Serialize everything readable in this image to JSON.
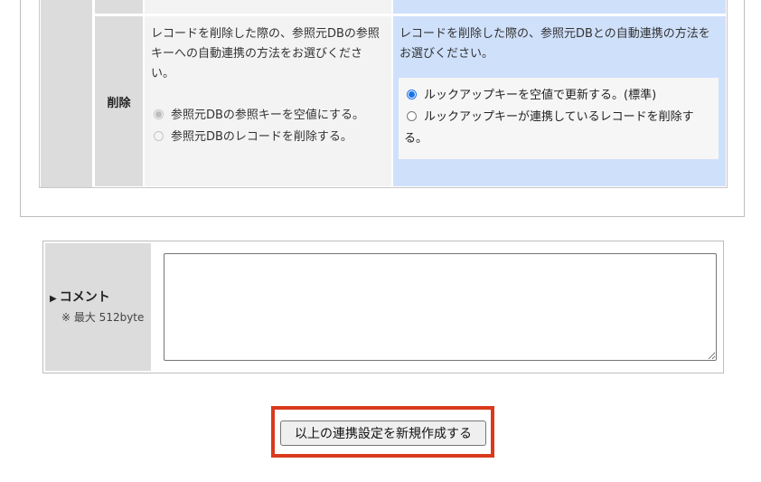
{
  "relation_settings": {
    "delete_row": {
      "label": "削除",
      "current_description": "レコードを削除した際の、参照元DBの参照キーへの自動連携の方法をお選びください。",
      "current_options": [
        {
          "label": "参照元DBの参照キーを空値にする。",
          "checked": true,
          "disabled": true
        },
        {
          "label": "参照元DBのレコードを削除する。",
          "checked": false,
          "disabled": true
        }
      ],
      "new_description": "レコードを削除した際の、参照元DBとの自動連携の方法をお選びください。",
      "new_options": [
        {
          "label": "ルックアップキーを空値で更新する。(標準)",
          "checked": true
        },
        {
          "label": "ルックアップキーが連携しているレコードを削除する。",
          "checked": false
        }
      ]
    }
  },
  "comment": {
    "title": "コメント",
    "note": "※ 最大 512byte",
    "value": ""
  },
  "submit": {
    "label": "以上の連携設定を新規作成する"
  },
  "colors": {
    "label_bg": "#dcdcdc",
    "current_bg": "#f3f3f3",
    "new_bg": "#cfe0fb",
    "highlight": "#d93a1c",
    "radio_accent": "#1a73e8"
  }
}
